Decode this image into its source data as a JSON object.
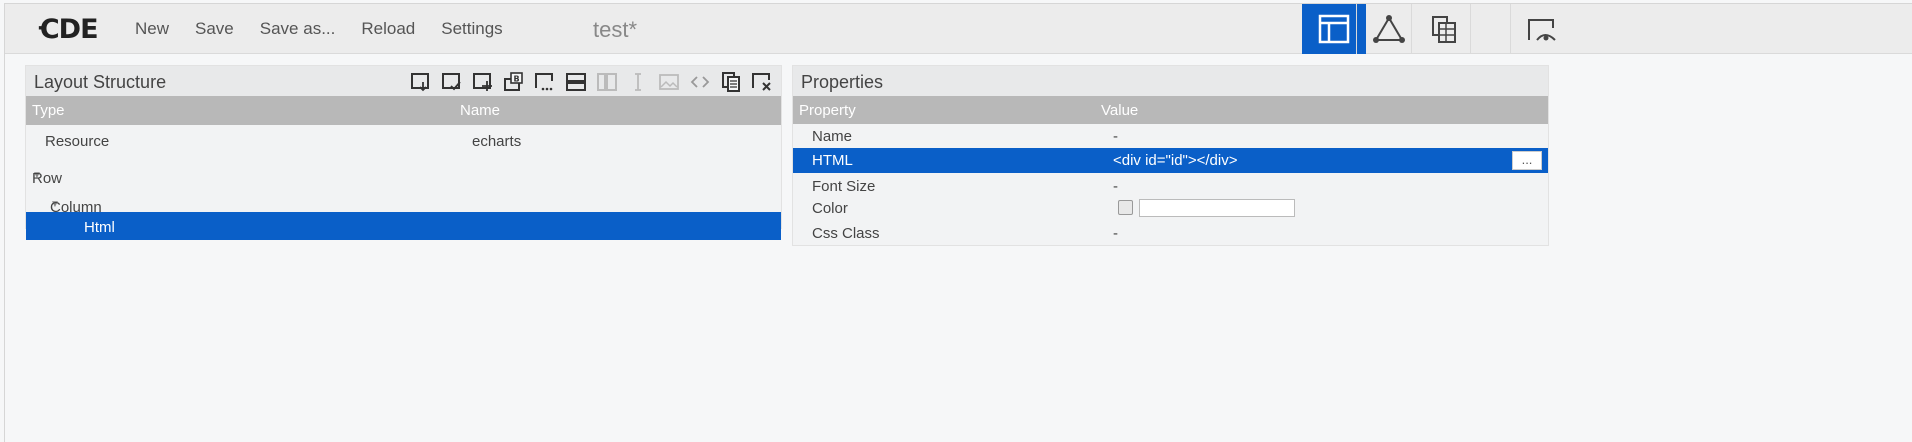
{
  "app": {
    "logo": "CDE",
    "doc_title": "test*"
  },
  "menu": [
    "New",
    "Save",
    "Save as...",
    "Reload",
    "Settings"
  ],
  "modes": [
    {
      "name": "layout",
      "icon": "layout-icon",
      "active": true
    },
    {
      "name": "components",
      "icon": "components-icon",
      "active": false
    },
    {
      "name": "datasources",
      "icon": "datasources-icon",
      "active": false
    },
    {
      "name": "preview",
      "icon": "preview-icon",
      "active": false
    }
  ],
  "layout_panel": {
    "title": "Layout Structure",
    "columns": {
      "type": "Type",
      "name": "Name"
    },
    "rows": [
      {
        "type": "Resource",
        "name": "echarts",
        "indent": 0,
        "caret": false,
        "selected": false
      },
      {
        "type": "Row",
        "name": "",
        "indent": 0,
        "caret": true,
        "selected": false
      },
      {
        "type": "Column",
        "name": "",
        "indent": 1,
        "caret": true,
        "selected": false
      },
      {
        "type": "Html",
        "name": "",
        "indent": 2,
        "caret": false,
        "selected": true
      }
    ],
    "toolbar": [
      "save-template-icon",
      "apply-template-icon",
      "add-resource-icon",
      "add-bootstrap-panel-icon",
      "add-freeform-icon",
      "add-row-icon",
      "add-columns-icon",
      "add-space-icon",
      "add-image-icon",
      "add-html-icon",
      "duplicate-icon",
      "delete-icon"
    ]
  },
  "properties_panel": {
    "title": "Properties",
    "columns": {
      "property": "Property",
      "value": "Value"
    },
    "rows": [
      {
        "property": "Name",
        "value": "-"
      },
      {
        "property": "HTML",
        "value": "<div id=\"id\"></div>",
        "button": "...",
        "selected": true
      },
      {
        "property": "Font Size",
        "value": "-"
      },
      {
        "property": "Color",
        "value": ""
      },
      {
        "property": "Css Class",
        "value": "-"
      }
    ]
  },
  "colors": {
    "accent": "#0a5fc8",
    "header": "#b8b8b8"
  }
}
